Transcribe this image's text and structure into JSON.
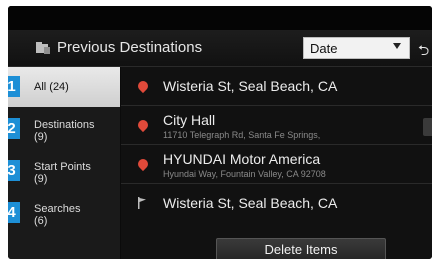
{
  "header": {
    "title": "Previous Destinations",
    "sort": {
      "value": "Date"
    }
  },
  "sidebar": {
    "tabs": [
      {
        "badge": "1",
        "label": "All (24)"
      },
      {
        "badge": "2",
        "label": "Destinations\n(9)"
      },
      {
        "badge": "3",
        "label": "Start Points\n(9)"
      },
      {
        "badge": "4",
        "label": "Searches\n(6)"
      }
    ]
  },
  "list": {
    "items": [
      {
        "icon": "location-pin-icon",
        "title": "Wisteria St, Seal Beach, CA",
        "subtitle": ""
      },
      {
        "icon": "location-pin-icon",
        "title": "City Hall",
        "subtitle": "11710 Telegraph Rd, Santa Fe Springs,"
      },
      {
        "icon": "location-pin-icon",
        "title": "HYUNDAI Motor America",
        "subtitle": "Hyundai Way, Fountain Valley, CA 92708"
      },
      {
        "icon": "flag-icon",
        "title": "Wisteria St, Seal Beach, CA",
        "subtitle": ""
      }
    ]
  },
  "footer": {
    "delete_label": "Delete Items"
  },
  "colors": {
    "badge": "#1d8fd6",
    "pin": "#e04a3a"
  }
}
